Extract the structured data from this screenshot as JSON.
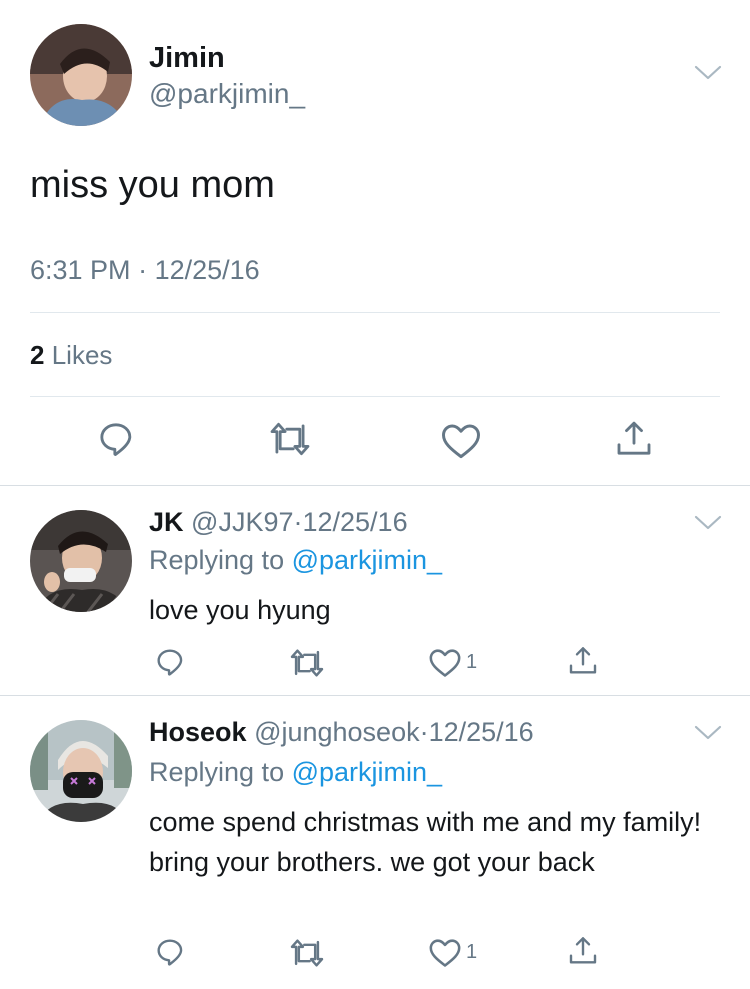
{
  "main_tweet": {
    "author_name": "Jimin",
    "author_handle": "@parkjimin_",
    "text": "miss you mom",
    "time": "6:31 PM",
    "separator": "·",
    "date": "12/25/16",
    "likes_count": "2",
    "likes_label": "Likes"
  },
  "replies": [
    {
      "author_name": "JK",
      "author_handle": "@JJK97",
      "separator": "·",
      "date": "12/25/16",
      "replying_prefix": "Replying to",
      "replying_to": "@parkjimin_",
      "text": "love you hyung",
      "like_count": "1"
    },
    {
      "author_name": "Hoseok",
      "author_handle": "@junghoseok",
      "separator": "·",
      "date": "12/25/16",
      "replying_prefix": "Replying to",
      "replying_to": "@parkjimin_",
      "text": "come spend christmas with me and my family! bring your brothers. we got your back",
      "like_count": "1"
    }
  ],
  "icons": {
    "reply": "reply-icon",
    "retweet": "retweet-icon",
    "like": "heart-icon",
    "share": "share-icon",
    "menu": "chevron-down-icon"
  },
  "colors": {
    "text": "#14171a",
    "muted": "#657786",
    "link": "#1b95e0",
    "divider": "#e1e8ed"
  }
}
